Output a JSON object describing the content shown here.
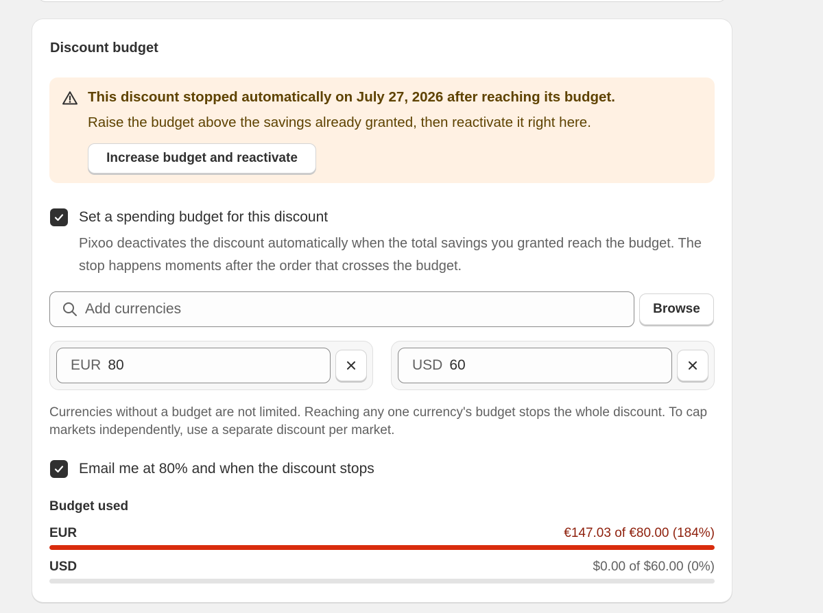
{
  "card": {
    "title": "Discount budget"
  },
  "banner": {
    "icon": "alert-triangle-icon",
    "title": "This discount stopped automatically on July 27, 2026 after reaching its budget.",
    "body": "Raise the budget above the savings already granted, then reactivate it right here.",
    "button_label": "Increase budget and reactivate",
    "bg_color": "#fff1e3",
    "text_color": "#5e4200"
  },
  "spending_budget": {
    "checked": true,
    "label": "Set a spending budget for this discount",
    "help": "Pixoo deactivates the discount automatically when the total savings you granted reach the budget. The stop happens moments after the order that crosses the budget."
  },
  "currency_search": {
    "placeholder": "Add currencies",
    "browse_label": "Browse"
  },
  "currencies": [
    {
      "code": "EUR",
      "value": "80"
    },
    {
      "code": "USD",
      "value": "60"
    }
  ],
  "note": "Currencies without a budget are not limited. Reaching any one currency's budget stops the whole discount. To cap markets independently, use a separate discount per market.",
  "email_alert": {
    "checked": true,
    "label": "Email me at 80% and when the discount stops"
  },
  "budget_used": {
    "title": "Budget used",
    "rows": [
      {
        "code": "EUR",
        "amount": "€147.03 of €80.00 (184%)",
        "fraction": 1.84,
        "color": "#d92c0d",
        "text_color": "#8e1f0b"
      },
      {
        "code": "USD",
        "amount": "$0.00 of $60.00 (0%)",
        "fraction": 0,
        "color": "#d92c0d",
        "text_color": "#616161"
      }
    ]
  }
}
